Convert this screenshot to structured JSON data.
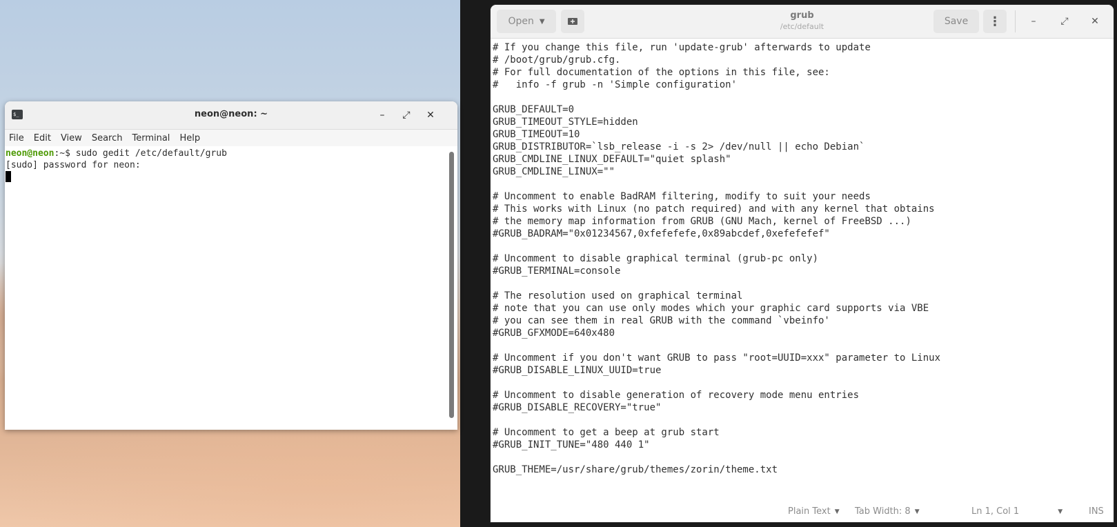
{
  "terminal": {
    "title": "neon@neon: ~",
    "menu": [
      "File",
      "Edit",
      "View",
      "Search",
      "Terminal",
      "Help"
    ],
    "prompt_user": "neon@neon",
    "prompt_rest": ":~$ sudo gedit /etc/default/grub",
    "line2": "[sudo] password for neon:"
  },
  "gedit": {
    "open_label": "Open",
    "save_label": "Save",
    "title": "grub",
    "subtitle": "/etc/default",
    "lines": [
      "# If you change this file, run 'update-grub' afterwards to update",
      "# /boot/grub/grub.cfg.",
      "# For full documentation of the options in this file, see:",
      "#   info -f grub -n 'Simple configuration'",
      "",
      "GRUB_DEFAULT=0",
      "GRUB_TIMEOUT_STYLE=hidden",
      "GRUB_TIMEOUT=10",
      "GRUB_DISTRIBUTOR=`lsb_release -i -s 2> /dev/null || echo Debian`",
      "GRUB_CMDLINE_LINUX_DEFAULT=\"quiet splash\"",
      "GRUB_CMDLINE_LINUX=\"\"",
      "",
      "# Uncomment to enable BadRAM filtering, modify to suit your needs",
      "# This works with Linux (no patch required) and with any kernel that obtains",
      "# the memory map information from GRUB (GNU Mach, kernel of FreeBSD ...)",
      "#GRUB_BADRAM=\"0x01234567,0xfefefefe,0x89abcdef,0xefefefef\"",
      "",
      "# Uncomment to disable graphical terminal (grub-pc only)",
      "#GRUB_TERMINAL=console",
      "",
      "# The resolution used on graphical terminal",
      "# note that you can use only modes which your graphic card supports via VBE",
      "# you can see them in real GRUB with the command `vbeinfo'",
      "#GRUB_GFXMODE=640x480",
      "",
      "# Uncomment if you don't want GRUB to pass \"root=UUID=xxx\" parameter to Linux",
      "#GRUB_DISABLE_LINUX_UUID=true",
      "",
      "# Uncomment to disable generation of recovery mode menu entries",
      "#GRUB_DISABLE_RECOVERY=\"true\"",
      "",
      "# Uncomment to get a beep at grub start",
      "#GRUB_INIT_TUNE=\"480 440 1\"",
      "",
      "GRUB_THEME=/usr/share/grub/themes/zorin/theme.txt"
    ],
    "status": {
      "language": "Plain Text",
      "tab_width": "Tab Width: 8",
      "position": "Ln 1, Col 1",
      "mode": "INS"
    }
  }
}
